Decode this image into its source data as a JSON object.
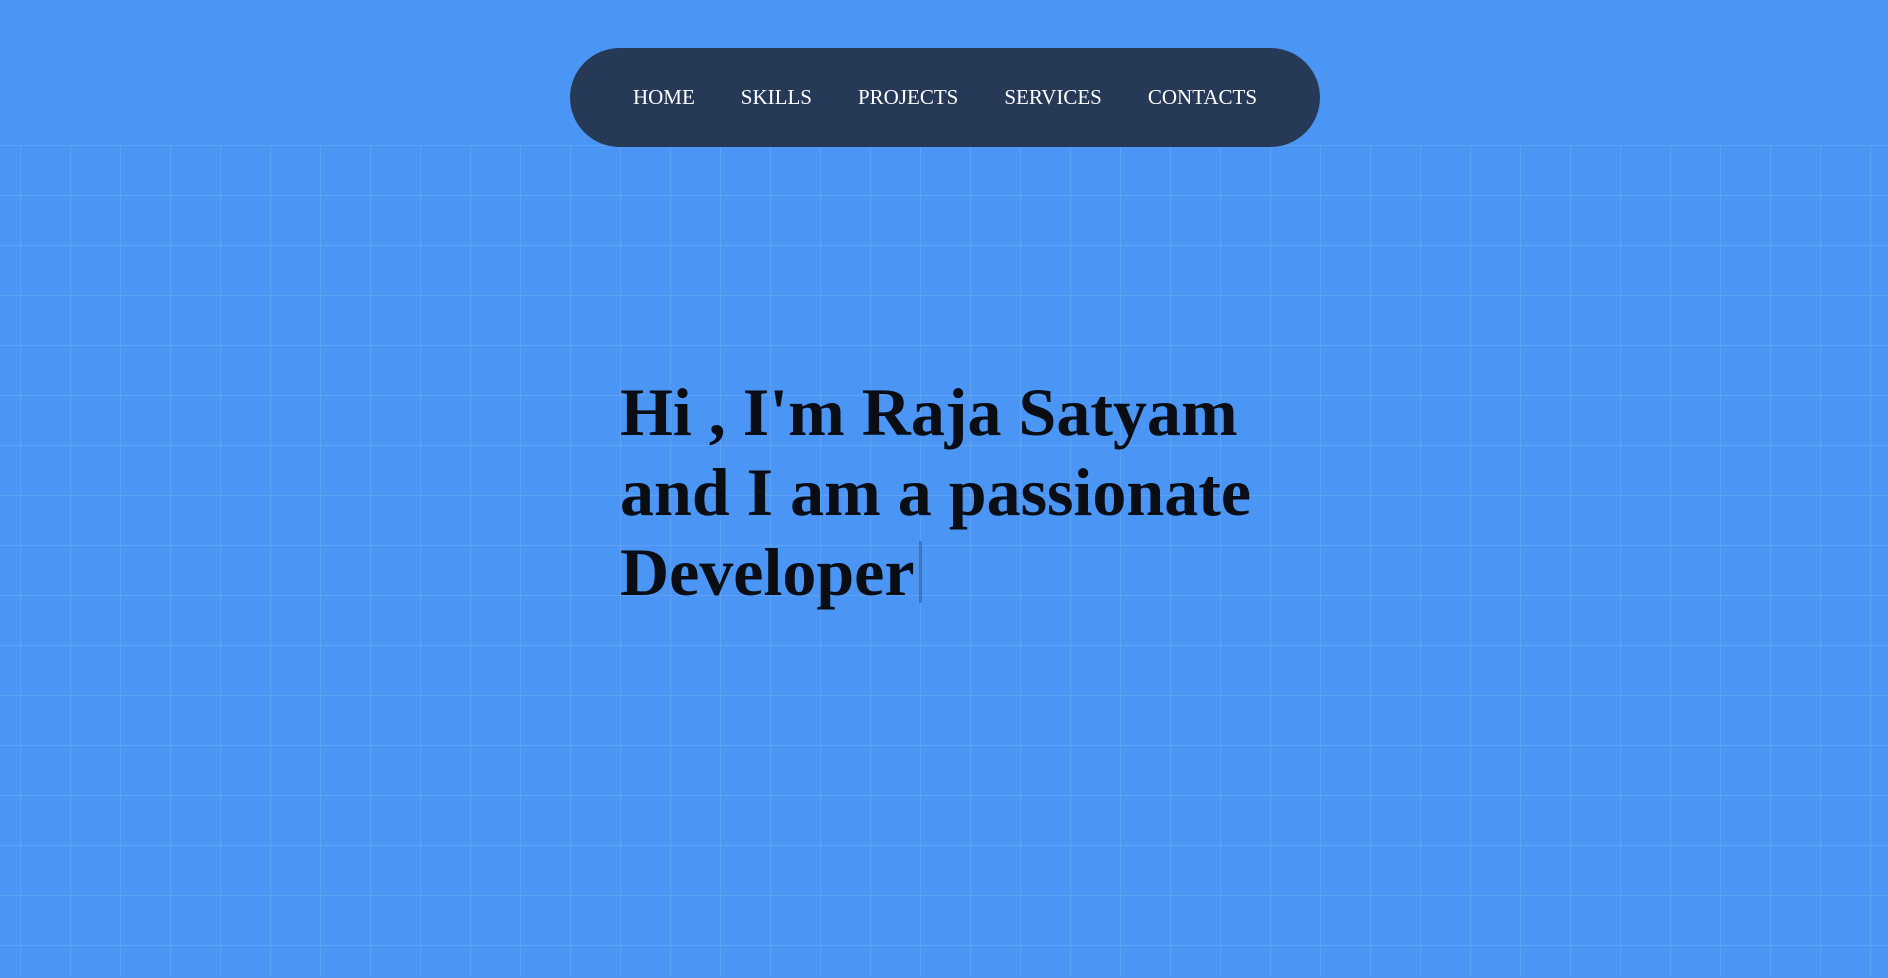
{
  "nav": {
    "items": [
      {
        "label": "HOME"
      },
      {
        "label": "SKILLS"
      },
      {
        "label": "PROJECTS"
      },
      {
        "label": "SERVICES"
      },
      {
        "label": "CONTACTS"
      }
    ]
  },
  "hero": {
    "line1": "Hi , I'm Raja Satyam",
    "line2": "and I am a passionate",
    "line3": "Developer"
  },
  "colors": {
    "background": "#4b96f4",
    "navbar": "#263a58",
    "nav_text": "#ffffff",
    "hero_text": "#0a0e14"
  }
}
